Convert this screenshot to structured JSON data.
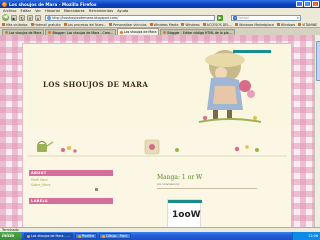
{
  "window": {
    "title": "Los shoujos de Mara - Mozilla Firefox",
    "controls": [
      "_",
      "□",
      "×"
    ]
  },
  "menu": [
    "Archivo",
    "Editar",
    "Ver",
    "Historial",
    "Marcadores",
    "Herramientas",
    "Ayuda"
  ],
  "nav": {
    "url": "http://losshoujosdemara.blogspot.com/",
    "search_placeholder": "Yahoo!"
  },
  "bookmarks": [
    "Más visitados",
    "Hotmail gratuito",
    "Los procesos del Nuev...",
    "Personalizar vínculos",
    "Windows Media",
    "Windows",
    "ACCESOS DEL...",
    "Windows Marketplace",
    "Windows",
    "VITAMINE"
  ],
  "tabs": [
    {
      "label": "Los shoujos de Mara",
      "active": false
    },
    {
      "label": "Blogger: Los shoujos de Mara - Crea...",
      "active": false
    },
    {
      "label": "Los shoujos de Mara",
      "active": true
    },
    {
      "label": "Blogger - Editar código HTML de la pla...",
      "active": false
    }
  ],
  "blog": {
    "title": "LOS SHOUJOS DE MARA",
    "sidebar": {
      "about_heading": "ABOUT",
      "about_lines": [
        "Perfil libre",
        "Sobre_Mara"
      ],
      "labels_heading": "LABELS"
    },
    "post": {
      "title": "Manga: 1 or W",
      "subtitle": "por Lluviasaurio",
      "image_logo": "1ooW"
    }
  },
  "status": "Terminado",
  "taskbar": {
    "start": "inicio",
    "tasks": [
      {
        "label": "Los shoujos de Mara - ...",
        "active": true
      },
      {
        "label": "Pixelfire",
        "active": false
      },
      {
        "label": "Dibujo - Paint",
        "active": false
      }
    ],
    "clock": "12:06"
  },
  "colors": {
    "titlebar": "#0a3fbf",
    "gingham_pink": "#e296b4",
    "page_bg": "#fbf7e4",
    "sidebar_heading": "#d36f98",
    "post_title": "#4a8a1e",
    "blog_title": "#3e2a12"
  }
}
